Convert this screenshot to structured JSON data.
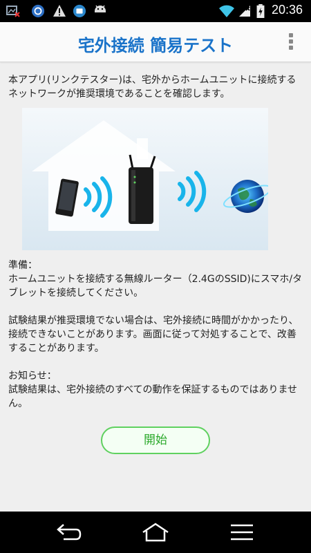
{
  "status_bar": {
    "time": "20:36",
    "icons": [
      "image-notification-icon",
      "sync-icon",
      "warning-icon",
      "app-notification-icon",
      "android-icon",
      "wifi-icon",
      "no-sim-icon",
      "battery-icon"
    ]
  },
  "app_bar": {
    "title": "宅外接続 簡易テスト",
    "menu_icon": "overflow-menu-icon"
  },
  "intro": "本アプリ(リンクテスター)は、宅外からホームユニットに接続するネットワークが推奨環境であることを確認します。",
  "illustration": {
    "icons": [
      "house-icon",
      "smartphone-icon",
      "wireless-signal-icon",
      "router-icon",
      "globe-icon"
    ]
  },
  "sections": {
    "prep_label": "準備：",
    "prep_text": "ホームユニットを接続する無線ルーター（2.4GのSSID)にスマホ/タブレットを接続してください。",
    "result_text": "試験結果が推奨環境でない場合は、宅外接続に時間がかかったり、接続できないことがあります。画面に従って対処することで、改善することがあります。",
    "notice_label": "お知らせ：",
    "notice_text": "試験結果は、宅外接続のすべての動作を保証するものではありません。"
  },
  "start_button": "開始",
  "nav_bar": {
    "icons": [
      "back-icon",
      "home-icon",
      "menu-icon"
    ]
  },
  "colors": {
    "title": "#1a73c9",
    "button_border": "#5fd15f",
    "button_text": "#2ba92b",
    "signal": "#19b4ea"
  }
}
